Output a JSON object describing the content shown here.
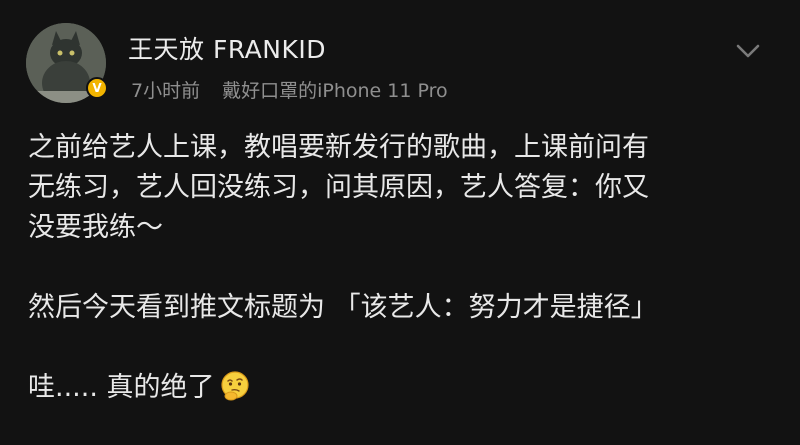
{
  "post": {
    "username": "王天放 FRANKID",
    "time": "7小时前",
    "device": "戴好口罩的iPhone 11 Pro",
    "verified_badge": "V",
    "more_icon": "chevron-down-icon",
    "lines": [
      "之前给艺人上课，教唱要新发行的歌曲，上课前问有",
      "无练习，艺人回没练习，问其原因，艺人答复：你又",
      "没要我练～"
    ],
    "line_4": "然后今天看到推文标题为 「该艺人：努力才是捷径」",
    "line_5": "哇..... 真的绝了",
    "emoji": "thinking-face-emoji"
  },
  "colors": {
    "background": "#121212",
    "text": "#e8e8e8",
    "meta_text": "#8f8f8f",
    "badge": "#f2b400"
  }
}
